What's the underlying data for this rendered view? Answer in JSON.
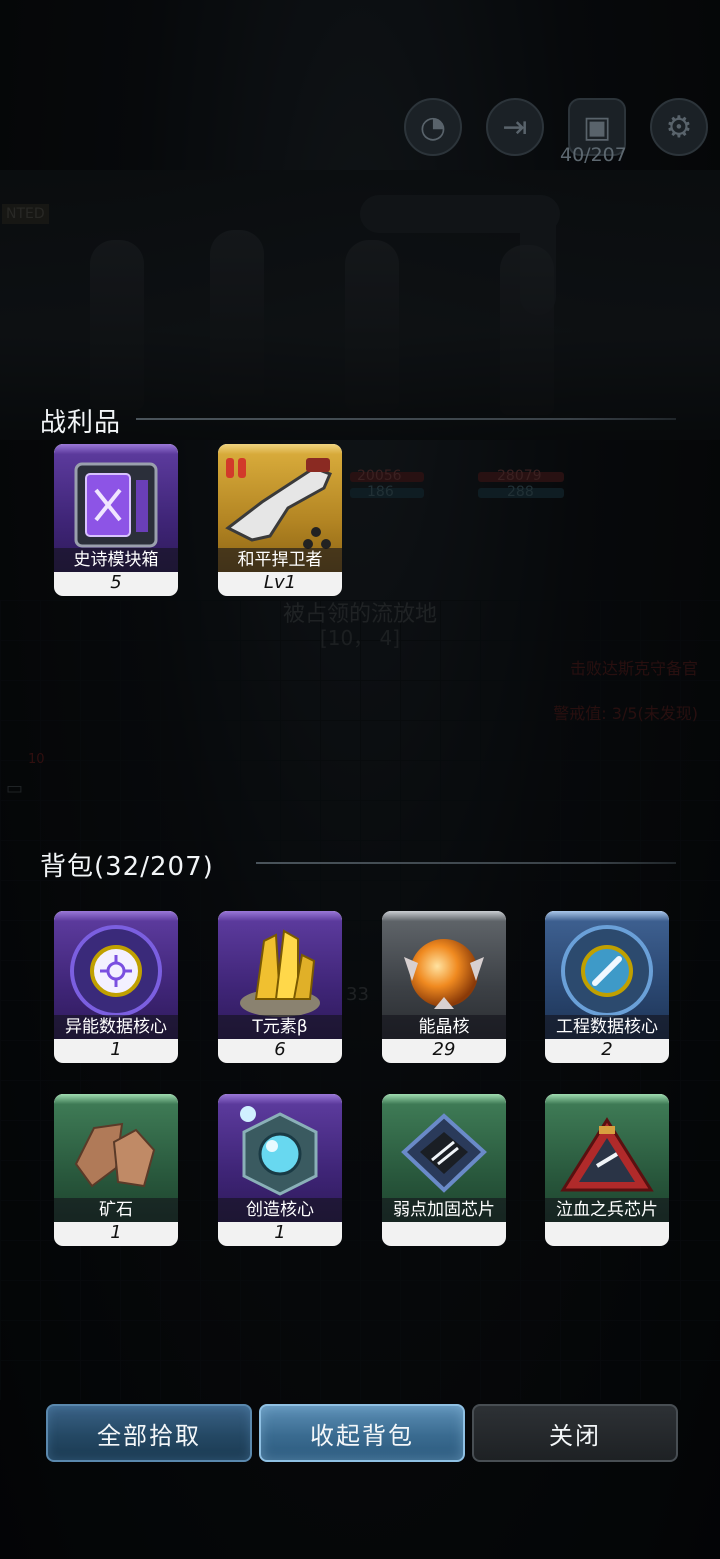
{
  "hud": {
    "bag_count": "40/207",
    "icons": [
      "radar-icon",
      "exit-door-icon",
      "bag-icon",
      "gear-icon"
    ]
  },
  "background": {
    "poster": "NTED",
    "map_name": "被占领的流放地",
    "coords": "[10， 4]",
    "quest": "击败达斯克守备官",
    "alert": "警戒值: 3/5(未发现)",
    "enemy_hp_1": "20056",
    "enemy_sp_1": "186",
    "enemy_hp_2": "28079",
    "enemy_sp_2": "288",
    "chat_badge": "10",
    "floor_num": "33"
  },
  "loot": {
    "title": "战利品",
    "items": [
      {
        "name": "史诗模块箱",
        "count": "5",
        "rarity": "purple",
        "icon": "module-crate-icon"
      },
      {
        "name": "和平捍卫者",
        "count": "Lv1",
        "rarity": "gold",
        "icon": "rifle-icon"
      }
    ]
  },
  "backpack": {
    "title": "背包(32/207)",
    "items": [
      {
        "name": "异能数据核心",
        "count": "1",
        "rarity": "purple",
        "icon": "psionic-core-icon"
      },
      {
        "name": "T元素β",
        "count": "6",
        "rarity": "purple",
        "icon": "crystal-icon"
      },
      {
        "name": "能晶核",
        "count": "29",
        "rarity": "gray",
        "icon": "energy-orb-icon"
      },
      {
        "name": "工程数据核心",
        "count": "2",
        "rarity": "blue",
        "icon": "engineering-core-icon"
      },
      {
        "name": "矿石",
        "count": "1",
        "rarity": "green",
        "icon": "ore-icon"
      },
      {
        "name": "创造核心",
        "count": "1",
        "rarity": "purple",
        "icon": "creation-core-icon"
      },
      {
        "name": "弱点加固芯片",
        "count": "",
        "rarity": "green",
        "icon": "chip-icon"
      },
      {
        "name": "泣血之兵芯片",
        "count": "",
        "rarity": "green",
        "icon": "triangle-chip-icon"
      }
    ]
  },
  "buttons": {
    "pickup_all": "全部拾取",
    "collapse_bag": "收起背包",
    "close": "关闭"
  },
  "colors": {
    "purple": "#5b3a9c",
    "gold": "#d7aa3a",
    "gray": "#5e6368",
    "blue": "#3d5f8f",
    "green": "#3e7a55",
    "button_blue": "#244864"
  }
}
